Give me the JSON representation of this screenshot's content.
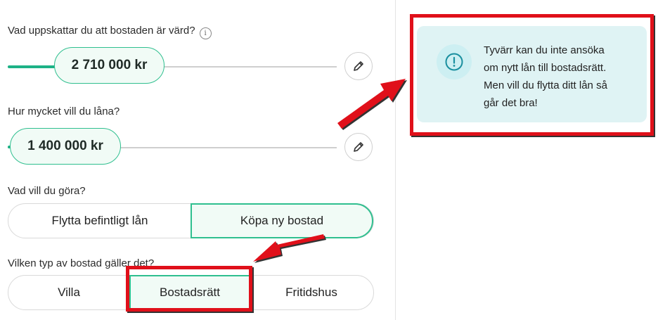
{
  "form": {
    "value_question": "Vad uppskattar du att bostaden är värd?",
    "value_amount": "2 710 000 kr",
    "value_fill_fraction": 0.13,
    "loan_question": "Hur mycket vill du låna?",
    "loan_amount": "1 400 000 kr",
    "loan_fill_fraction": 0.0,
    "action_question": "Vad vill du göra?",
    "action_options": [
      "Flytta befintligt lån",
      "Köpa ny bostad"
    ],
    "action_selected": "Köpa ny bostad",
    "type_question": "Vilken typ av bostad gäller det?",
    "type_options": [
      "Villa",
      "Bostadsrätt",
      "Fritidshus"
    ],
    "type_selected": "Bostadsrätt"
  },
  "info": {
    "message": "Tyvärr kan du inte ansöka om nytt lån till bostadsrätt. Men vill du flytta ditt lån så går det bra!",
    "lines": [
      "Tyvärr kan du inte ansöka",
      "om nytt lån till bostadsrätt.",
      "Men vill du flytta ditt lån så",
      "går det bra!"
    ]
  },
  "colors": {
    "accent": "#1db286",
    "pill_border": "#2fbf8f",
    "info_bg": "#dff3f4",
    "info_icon": "#1a8f9f",
    "highlight": "#e0101a"
  },
  "icons": {
    "info": "info-icon",
    "edit": "pencil-icon",
    "alert": "exclamation-circle-icon"
  }
}
